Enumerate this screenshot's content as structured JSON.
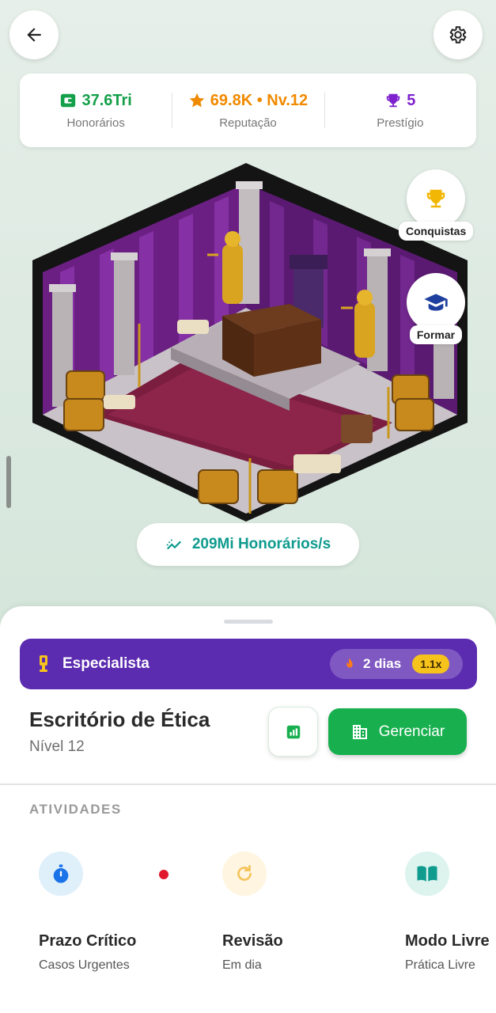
{
  "header": {
    "back_icon": "arrow-left-icon",
    "settings_icon": "gear-icon"
  },
  "stats": [
    {
      "value": "37.6Tri",
      "label": "Honorários",
      "icon": "wallet-icon",
      "color": "#14a04a"
    },
    {
      "value": "69.8K • Nv.12",
      "label": "Reputação",
      "icon": "star-icon",
      "color": "#f08a00"
    },
    {
      "value": "5",
      "label": "Prestígio",
      "icon": "trophy-icon",
      "color": "#7e22ce"
    }
  ],
  "side_buttons": {
    "conquistas": {
      "label": "Conquistas",
      "icon": "trophy-icon"
    },
    "formar": {
      "label": "Formar",
      "icon": "graduation-cap-icon"
    }
  },
  "income": {
    "rate": "209Mi Honorários/s",
    "icon": "trend-up-icon"
  },
  "banner": {
    "title": "Especialista",
    "icon": "medal-icon",
    "streak": "2 dias",
    "streak_icon": "flame-icon",
    "multiplier": "1.1x"
  },
  "office": {
    "name": "Escritório de Ética",
    "level": "Nível 12",
    "manage_label": "Gerenciar",
    "manage_icon": "building-icon",
    "stats_icon": "bar-chart-icon"
  },
  "activities": {
    "section_title": "ATIVIDADES",
    "items": [
      {
        "title": "Prazo Crítico",
        "subtitle": "Casos Urgentes",
        "icon": "stopwatch-icon",
        "notification": true
      },
      {
        "title": "Revisão",
        "subtitle": "Em dia",
        "icon": "refresh-icon"
      },
      {
        "title": "Modo Livre",
        "subtitle": "Prática Livre",
        "icon": "open-book-icon"
      }
    ]
  },
  "colors": {
    "accent_green": "#18b04e",
    "banner_purple": "#5b2bb0",
    "income_teal": "#0f9b8e"
  }
}
